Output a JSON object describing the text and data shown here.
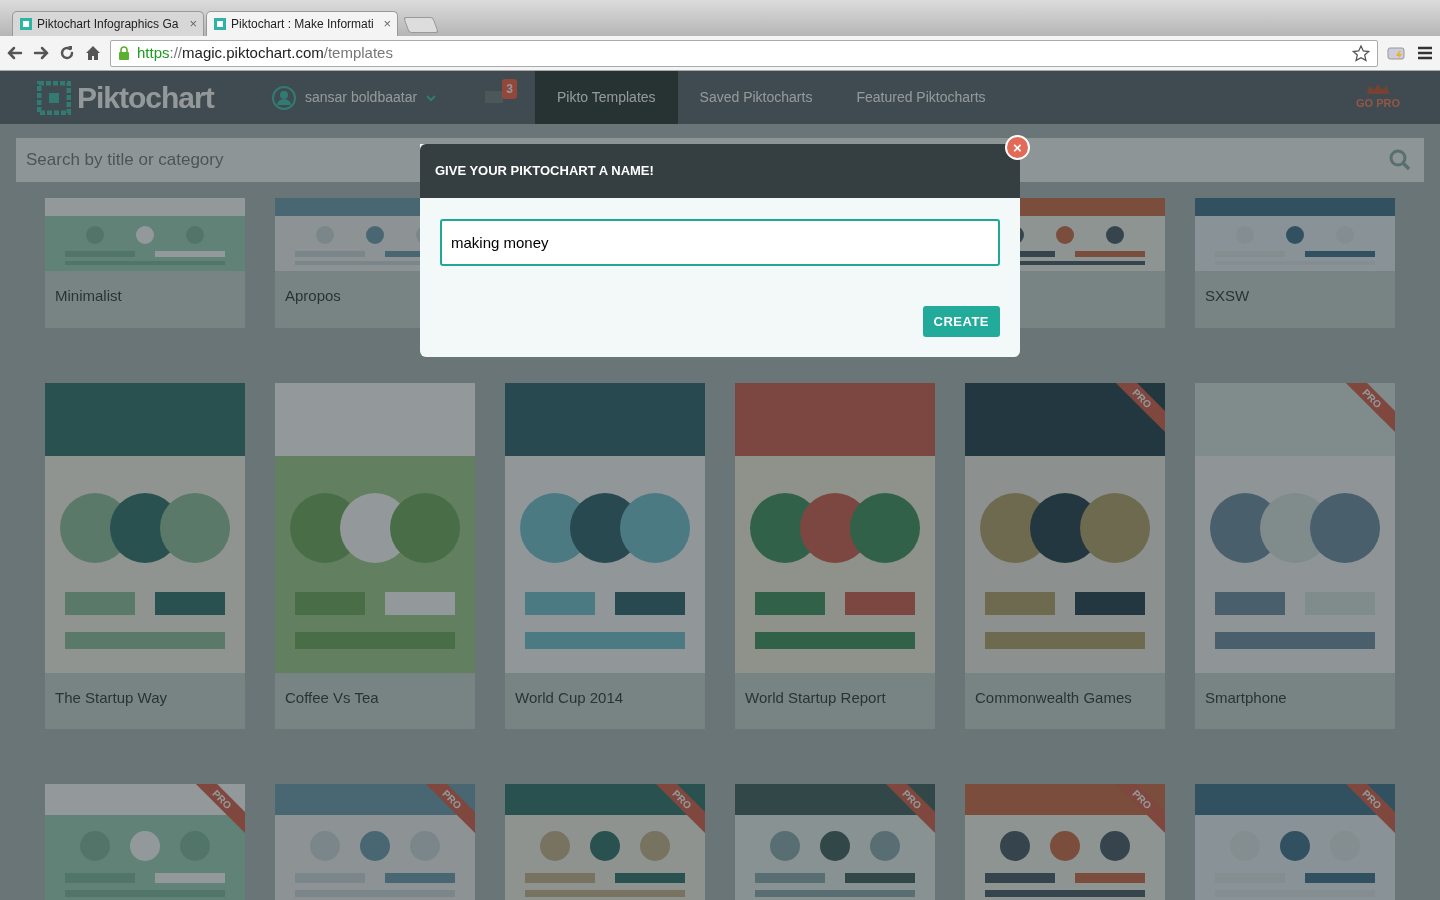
{
  "browser": {
    "tabs": [
      {
        "title": "Piktochart Infographics Ga",
        "close": "×",
        "selected": false
      },
      {
        "title": "Piktochart : Make Informati",
        "close": "×",
        "selected": true
      }
    ],
    "url": {
      "scheme": "https",
      "separator": "://",
      "host": "magic.piktochart.com",
      "path": "/templates"
    }
  },
  "app": {
    "logo": "Piktochart",
    "user": "sansar boldbaatar",
    "notifications": "3",
    "nav": [
      {
        "label": "Pikto Templates",
        "selected": true
      },
      {
        "label": "Saved Piktocharts",
        "selected": false
      },
      {
        "label": "Featured Piktocharts",
        "selected": false
      }
    ],
    "go_pro": "GO PRO",
    "search": {
      "placeholder": "Search by title or category"
    }
  },
  "template_rows": [
    [
      {
        "title": "Minimalist"
      },
      {
        "title": "Apropos"
      },
      {},
      {},
      {
        "kind": "picture"
      },
      {
        "title": "SXSW"
      }
    ],
    [
      {
        "title": "The Startup Way"
      },
      {
        "title": "Coffee Vs Tea"
      },
      {
        "title": "World Cup 2014"
      },
      {
        "title": "World Startup Report"
      },
      {
        "title": "Commonwealth Games",
        "pro": "PRO"
      },
      {
        "title": "Smartphone",
        "pro": "PRO"
      }
    ],
    [
      {
        "pro": "PRO"
      },
      {
        "pro": "PRO"
      },
      {
        "pro": "PRO"
      },
      {
        "pro": "PRO"
      },
      {
        "pro": "PRO"
      },
      {
        "pro": "PRO"
      }
    ]
  ],
  "dialog": {
    "title": "GIVE YOUR PIKTOCHART A NAME!",
    "name_value": "making money",
    "button": "CREATE",
    "close": "×"
  }
}
